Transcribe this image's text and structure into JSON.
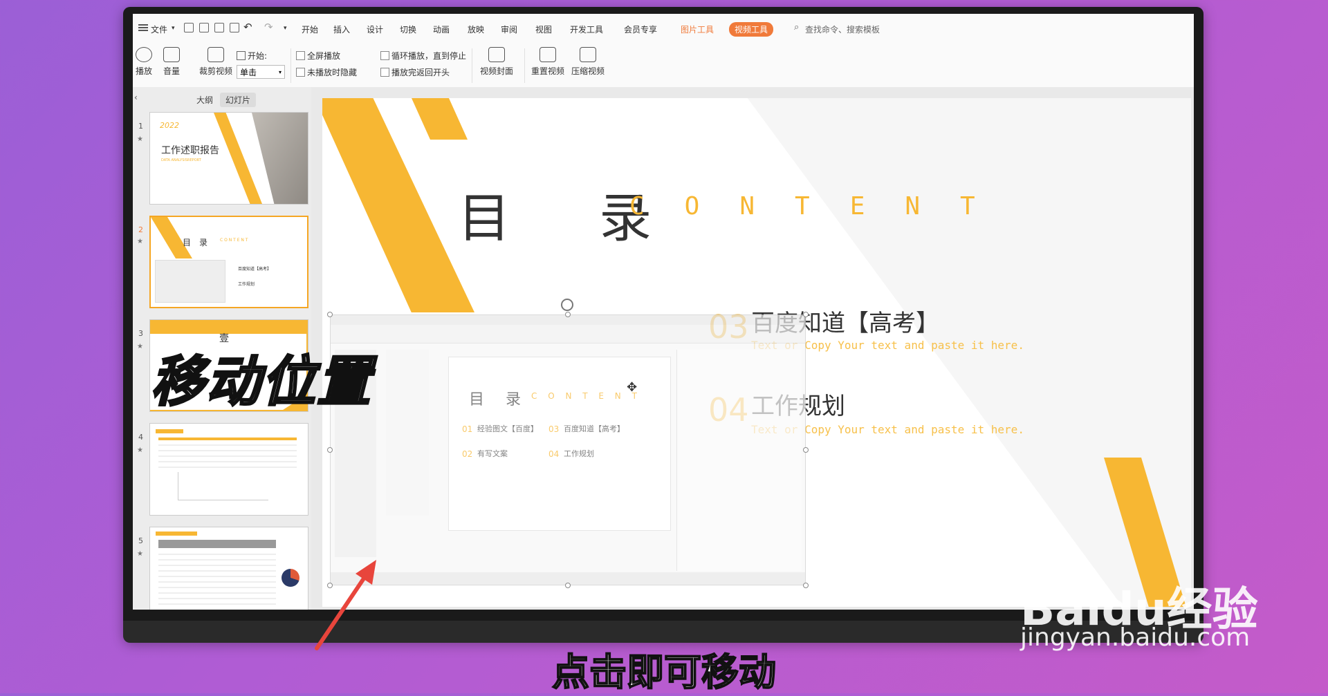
{
  "ribbon": {
    "file_label": "文件",
    "tabs": [
      "开始",
      "插入",
      "设计",
      "切换",
      "动画",
      "放映",
      "审阅",
      "视图",
      "开发工具",
      "会员专享"
    ],
    "picture_tools": "图片工具",
    "video_tools": "视频工具",
    "search_placeholder": "查找命令、搜索模板",
    "commands": {
      "play": "播放",
      "volume": "音量",
      "trim": "裁剪视频",
      "start_label": "开始:",
      "start_value": "单击",
      "fullscreen": "全屏播放",
      "hide_when_not_playing": "未播放时隐藏",
      "loop": "循环播放，直到停止",
      "rewind": "播放完返回开头",
      "cover": "视频封面",
      "reset": "重置视频",
      "compress": "压缩视频"
    },
    "colors": {
      "picture_tools": "#f07a3a",
      "video_tools": "#f07a3a"
    }
  },
  "pane": {
    "tab_outline": "大纲",
    "tab_slides": "幻灯片",
    "slides": [
      {
        "num": "1",
        "year": "2022",
        "title": "工作述职报告",
        "sub": "DATA ANALYSISREPORT"
      },
      {
        "num": "2",
        "title": "目　录",
        "sub": "C O N T E N T"
      },
      {
        "num": "3",
        "title": "壹"
      },
      {
        "num": "4"
      },
      {
        "num": "5"
      }
    ]
  },
  "slide": {
    "title": "目 录",
    "content_word": "CONTENT",
    "items": [
      {
        "num": "03",
        "title": "百度知道【高考】",
        "sub": "Text or Copy Your text and  paste it here."
      },
      {
        "num": "04",
        "title": "工作规划",
        "sub": "Text or Copy Your text and  paste it here."
      }
    ],
    "accent": "#f7b733"
  },
  "inserted_screenshot": {
    "title": "目 录",
    "content_word": "C O N T E N T",
    "items": [
      "经验图文【百度】",
      "百度知道【高考】",
      "有写文案",
      "工作规划"
    ],
    "nums": [
      "01",
      "03",
      "02",
      "04"
    ]
  },
  "overlay_text": "移动位置",
  "caption": "点击即可移动",
  "watermark": {
    "logo": "Baidu经验",
    "url": "jingyan.baidu.com"
  }
}
